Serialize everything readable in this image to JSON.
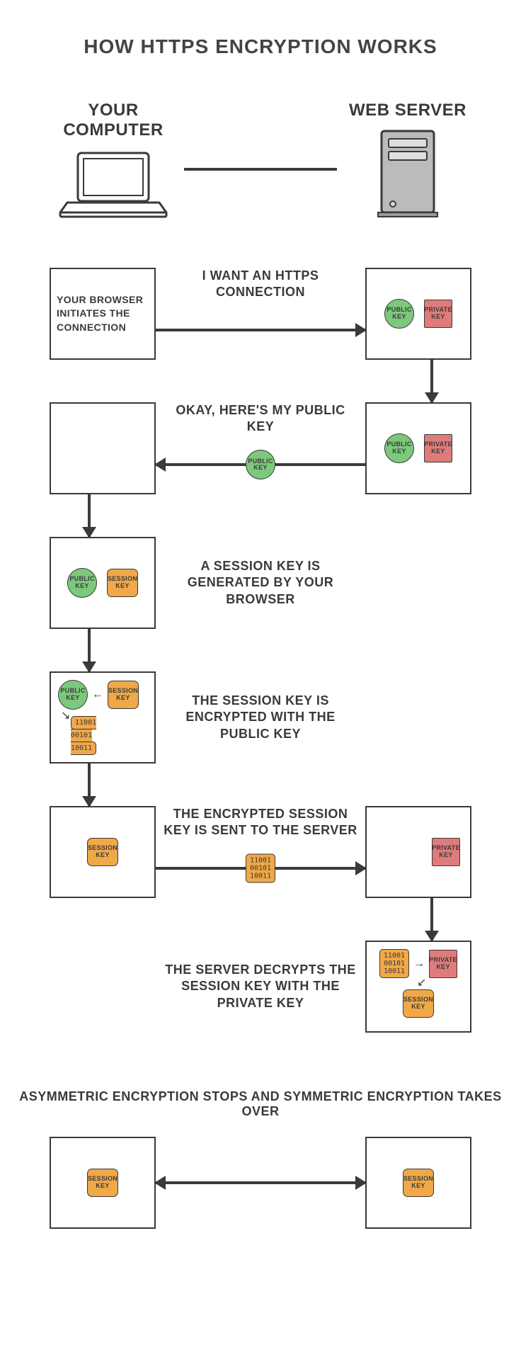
{
  "title": "HOW HTTPS ENCRYPTION WORKS",
  "header": {
    "client_label": "YOUR COMPUTER",
    "server_label": "WEB SERVER"
  },
  "keys": {
    "public": "PUBLIC KEY",
    "private": "PRIVATE KEY",
    "session": "SESSION KEY",
    "ciphertext": "11001\n00101\n10011"
  },
  "steps": {
    "s1": {
      "label": "I WANT AN HTTPS CONNECTION",
      "box_text": "YOUR BROWSER INITIATES THE CONNECTION"
    },
    "s2": {
      "label": "OKAY, HERE'S MY PUBLIC KEY"
    },
    "s3": {
      "label": "A SESSION KEY IS GENERATED BY YOUR BROWSER"
    },
    "s4": {
      "label": "THE SESSION KEY IS ENCRYPTED WITH THE PUBLIC KEY"
    },
    "s5": {
      "label": "THE ENCRYPTED SESSION KEY IS SENT TO THE SERVER"
    },
    "s6": {
      "label": "THE SERVER DECRYPTS THE SESSION KEY WITH THE PRIVATE KEY"
    }
  },
  "footer": "ASYMMETRIC ENCRYPTION STOPS AND SYMMETRIC ENCRYPTION TAKES OVER"
}
